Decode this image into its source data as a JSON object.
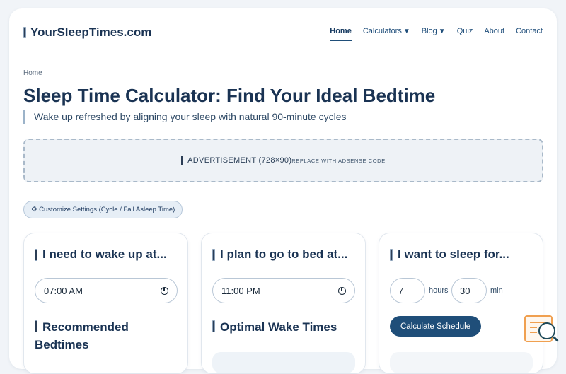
{
  "header": {
    "logo_text": "YourSleepTimes.com",
    "nav": [
      {
        "label": "Home",
        "active": true
      },
      {
        "label": "Calculators",
        "dropdown": true
      },
      {
        "label": "Blog",
        "dropdown": true
      },
      {
        "label": "Quiz"
      },
      {
        "label": "About"
      },
      {
        "label": "Contact"
      }
    ],
    "caret": "▼"
  },
  "breadcrumb": "Home",
  "page_title": "Sleep Time Calculator: Find Your Ideal Bedtime",
  "subtitle": "Wake up refreshed by aligning your sleep with natural 90-minute cycles",
  "ad": {
    "label": "ADVERTISEMENT (728×90)",
    "sub_label": "Replace with AdSense code"
  },
  "settings_button": "⚙ Customize Settings (Cycle / Fall Asleep Time)",
  "cards": {
    "wake": {
      "title": "I need to wake up at...",
      "time_value": "07:00 AM",
      "section_title": "Recommended Bedtimes"
    },
    "bed": {
      "title": "I plan to go to bed at...",
      "time_value": "11:00 PM",
      "section_title": "Optimal Wake Times"
    },
    "duration": {
      "title": "I want to sleep for...",
      "hours_value": "7",
      "hours_unit": "hours",
      "minutes_value": "30",
      "minutes_unit": "min",
      "button_label": "Calculate Schedule"
    }
  },
  "colors": {
    "primary": "#1f4e79",
    "heading": "#1a3353",
    "accent_orange": "#f0a050"
  }
}
